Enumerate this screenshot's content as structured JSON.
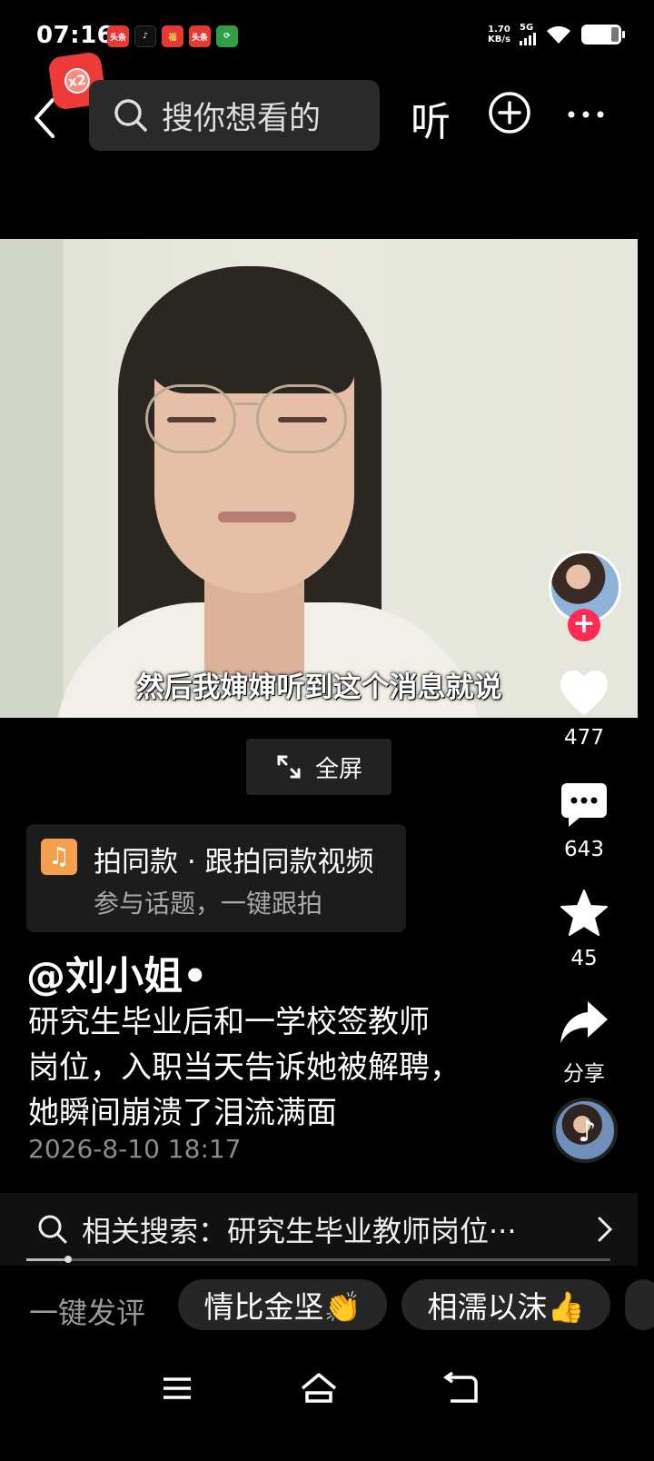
{
  "status": {
    "time": "07:16",
    "net_speed": "1.70\nKB/s",
    "net_speed_line1": "1.70",
    "net_speed_line2": "KB/s",
    "network_type": "5G",
    "notifications": [
      {
        "icon": "toutiao-icon",
        "label": "头条"
      },
      {
        "icon": "tiktok-icon",
        "label": "♪"
      },
      {
        "icon": "lucky-icon",
        "label": "福"
      },
      {
        "icon": "toutiao-icon",
        "label": "头条"
      },
      {
        "icon": "refresh-app-icon",
        "label": "⟳"
      }
    ]
  },
  "top_bar": {
    "badge": "x2",
    "search_placeholder": "搜你想看的",
    "listen_label": "听"
  },
  "video": {
    "subtitle": "然后我婶婶听到这个消息就说"
  },
  "fullscreen_label": "全屏",
  "actions": {
    "likes": "477",
    "comments": "643",
    "favorites": "45",
    "share_label": "分享"
  },
  "sync_card": {
    "title": "拍同款 · 跟拍同款视频",
    "subtitle": "参与话题，一键跟拍"
  },
  "post": {
    "author": "@刘小姐•",
    "description": "研究生毕业后和一学校签教师岗位，入职当天告诉她被解聘，她瞬间崩溃了泪流满面",
    "desc_lines": [
      "研究生毕业后和一学校签教师",
      "岗位，入职当天告诉她被解聘，",
      "她瞬间崩溃了泪流满面"
    ],
    "date": "2026-8-10 18:17"
  },
  "related_search": "相关搜索：研究生毕业教师岗位···",
  "quick_comment": {
    "label": "一键发评",
    "chips": [
      "情比金坚👏",
      "相濡以沫👍"
    ]
  },
  "colors": {
    "background": "#000000",
    "accent_red": "#fe2c55",
    "chip_bg": "#262626"
  }
}
